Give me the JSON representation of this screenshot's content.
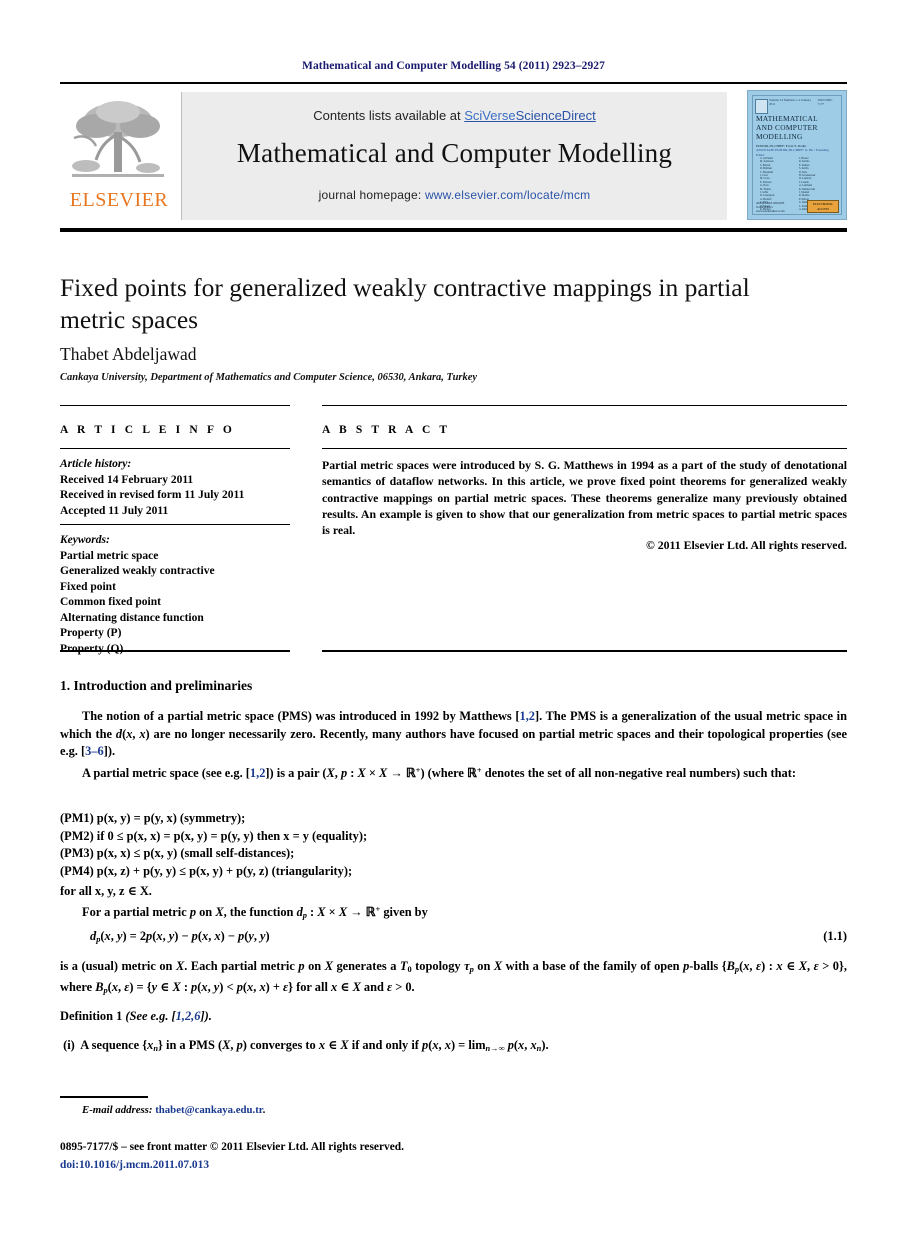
{
  "running_head": "Mathematical and Computer Modelling 54 (2011) 2923–2927",
  "masthead": {
    "contents_prefix": "Contents lists available at ",
    "sciverse": "SciVerse",
    "sciencedirect": "ScienceDirect",
    "journal_name": "Mathematical and Computer Modelling",
    "homepage_label": "journal homepage: ",
    "homepage_url": "www.elsevier.com/locate/mcm",
    "publisher_logo_text": "ELSEVIER",
    "logo_icon": "elsevier-tree-icon",
    "accent_orange": "#E87722",
    "link_blue": "#2b54a8",
    "panel_gray": "#ececec"
  },
  "cover": {
    "top_left": "Volume 54 Numbers 1-2   January 2011",
    "top_right": "ISSN 0895-7177",
    "title_line1": "MATHEMATICAL",
    "title_line2": "AND COMPUTER",
    "title_line3": "MODELLING",
    "editor_line1": "EDITOR-IN-CHIEF: Ervin Y. Rodin",
    "editor_line2": "ASSOCIATE EDITOR-IN-CHIEF: X. Hu  /  Founding Editor",
    "list_left": "A. Al-Fahed\nM. Anderson\nS. Barnett\nR. Bellman\nC. Brezinski\nJ. Casti\nM. Cross\nE. Davison\nG. Dorn\nM. Fiedler\nJ. Gillis\nD. Greenspan\nA. Haddad\nG. Hall\nP. Hansen\nR. Hartley",
    "list_right": "J. Hauser\nR. Kalaba\nE. Kamen\nS. Karlin\nD. Kirk\nH. Kwakernaak\nD. Lainiotis\nJ. Lasalle\nA. Leitmann\nK. Malanowski\nJ. Mandel\nR. Mohler\nP. Nelson\nS. Osher\nL. Padulo\nA. Rubinov",
    "footer_text": "AVAILABLE ONLINE\nScienceDirect\nwww.sciencedirect.com",
    "access_badge": "ELECTRONIC ACCESS",
    "bg_color": "#9ecbe6"
  },
  "article": {
    "title": "Fixed points for generalized weakly contractive mappings in partial metric spaces",
    "author": "Thabet Abdeljawad",
    "affiliation": "Cankaya University, Department of Mathematics and Computer Science, 06530, Ankara, Turkey"
  },
  "info": {
    "heading": "A R T I C L E    I N F O",
    "history_label": "Article history:",
    "history": [
      "Received 14 February 2011",
      "Received in revised form 11 July 2011",
      "Accepted 11 July 2011"
    ],
    "keywords_label": "Keywords:",
    "keywords": [
      "Partial metric space",
      "Generalized weakly contractive",
      "Fixed point",
      "Common fixed point",
      "Alternating distance function",
      "Property (P)",
      "Property (Q)"
    ]
  },
  "abstract": {
    "heading": "A B S T R A C T",
    "text": "Partial metric spaces were introduced by S. G. Matthews in 1994 as a part of the study of denotational semantics of dataflow networks. In this article, we prove fixed point theorems for generalized weakly contractive mappings on partial metric spaces. These theorems generalize many previously obtained results. An example is given to show that our generalization from metric spaces to partial metric spaces is real.",
    "copyright": "© 2011 Elsevier Ltd. All rights reserved."
  },
  "body": {
    "section_heading": "1. Introduction and preliminaries",
    "para1_a": "The notion of a partial metric space (PMS) was introduced in 1992 by Matthews [",
    "para1_cite1": "1,2",
    "para1_b": "]. The PMS is a generalization of the usual metric space in which the ",
    "para1_c": " are no longer necessarily zero. Recently, many authors have focused on partial metric spaces and their topological properties (see e.g. [",
    "para1_cite2": "3–6",
    "para1_d": "]).",
    "para2_a": "A partial metric space (see e.g. [",
    "para2_cite": "1,2",
    "para2_b": "]) is a pair ",
    "para2_c": " denotes the set of all non-negative real numbers) such that:",
    "axioms": [
      "(PM1)  p(x, y) = p(y, x) (symmetry);",
      "(PM2)  if 0 ≤ p(x, x) = p(x, y) = p(y, y) then x = y (equality);",
      "(PM3)  p(x, x) ≤ p(x, y) (small self-distances);",
      "(PM4)  p(x, z) + p(y, y) ≤ p(x, y) + p(y, z) (triangularity);"
    ],
    "forall_line": "for all x, y, z ∈ X.",
    "para_dp": "For a partial metric p on X, the function d_p : X × X → ℝ+ given by",
    "equation": "d_p(x, y) = 2p(x, y) − p(x, x) − p(y, y)",
    "equation_number": "(1.1)",
    "para3": "is a (usual) metric on X. Each partial metric p on X generates a T0 topology τp on X with a base of the family of open p-balls {Bp(x, ε) : x ∈ X, ε > 0}, where Bp(x, ε) = {y ∈ X : p(x, y) < p(x, x) + ε} for all x ∈ X and ε > 0.",
    "definition_label": "Definition 1",
    "definition_source_a": "(See e.g. [",
    "definition_cite": "1,2,6",
    "definition_source_b": "]).",
    "def_item_i": "(i)  A sequence {xn} in a PMS (X, p) converges to x ∈ X if and only if p(x, x) = limn→∞ p(x, xn)."
  },
  "footer": {
    "email_label": "E-mail address:",
    "email": "thabet@cankaya.edu.tr",
    "email_suffix": ".",
    "issn_line": "0895-7177/$ – see front matter © 2011 Elsevier Ltd. All rights reserved.",
    "doi_line": "doi:10.1016/j.mcm.2011.07.013",
    "link_color": "#1a3a8f"
  }
}
